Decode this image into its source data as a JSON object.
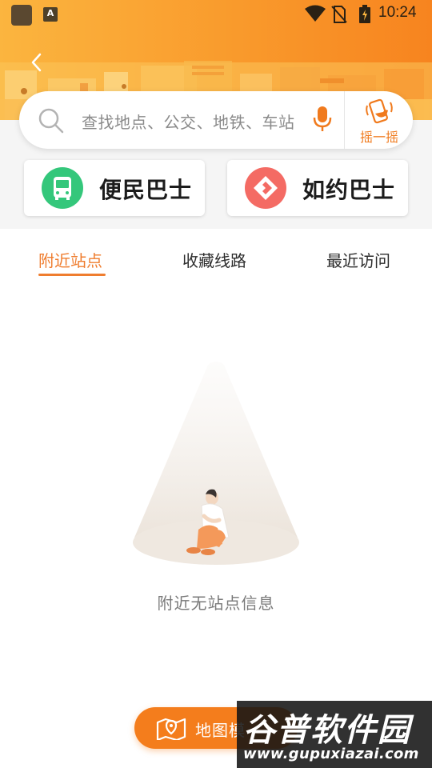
{
  "status_bar": {
    "time": "10:24"
  },
  "search": {
    "placeholder": "查找地点、公交、地铁、车站",
    "shake_label": "摇一摇"
  },
  "services": [
    {
      "label": "便民巴士",
      "icon": "bus-icon",
      "color": "#34c77b"
    },
    {
      "label": "如约巴士",
      "icon": "reservation-icon",
      "color": "#f46b64"
    }
  ],
  "tabs": [
    {
      "label": "附近站点",
      "active": true
    },
    {
      "label": "收藏线路",
      "active": false
    },
    {
      "label": "最近访问",
      "active": false
    }
  ],
  "empty_state": {
    "message": "附近无站点信息"
  },
  "map_button": {
    "label": "地图模"
  },
  "watermark": {
    "title": "谷普软件园",
    "url": "www.gupuxiazai.com"
  },
  "colors": {
    "header_start": "#fbb53f",
    "header_end": "#f7841f",
    "accent": "#ef7d2f",
    "map_button": "#f47d1c"
  }
}
